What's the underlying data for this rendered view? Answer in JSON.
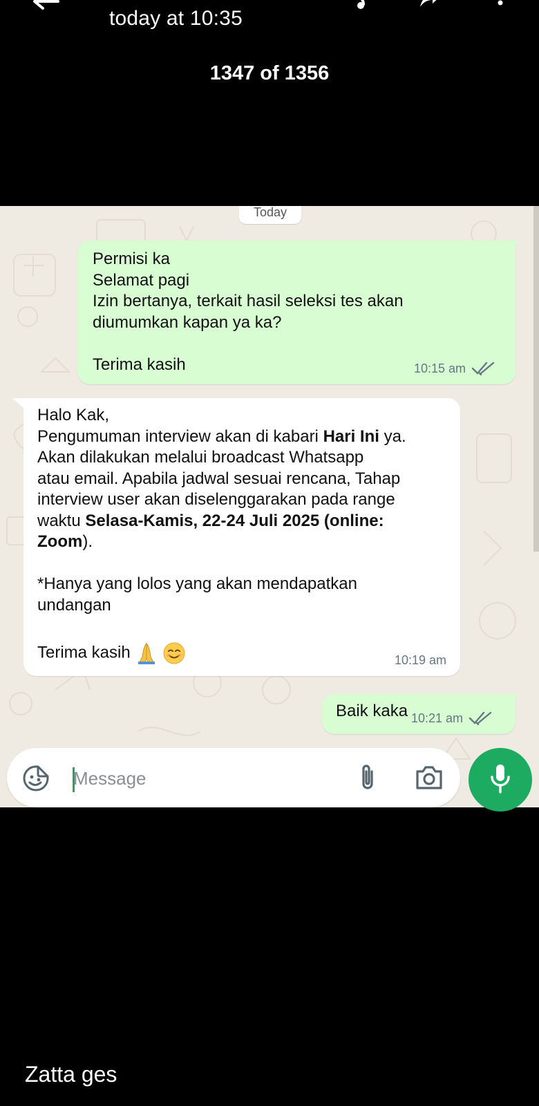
{
  "viewer": {
    "time": "today at 10:35",
    "counter": "1347 of 1356",
    "caption": "Zatta ges"
  },
  "chat": {
    "date_chip": "Today",
    "messages": [
      {
        "direction": "outgoing",
        "lines": [
          "Permisi ka",
          "Selamat pagi",
          "Izin bertanya, terkait hasil seleksi tes akan",
          "diumumkan kapan ya ka?",
          "",
          "Terima kasih"
        ],
        "time": "10:15 am",
        "status": "read"
      },
      {
        "direction": "incoming",
        "greeting": "Halo Kak,",
        "line2_pre": "Pengumuman interview akan di kabari ",
        "line2_bold": "Hari Ini",
        "line2_post": " ya.",
        "line3": "Akan dilakukan melalui broadcast Whatsapp",
        "line4": "atau email. Apabila jadwal sesuai rencana, Tahap",
        "line5": "interview user akan diselenggarakan pada range",
        "line6_pre": "waktu ",
        "line6_bold": "Selasa-Kamis, 22-24 Juli 2025 (online:",
        "line7_bold": "Zoom",
        "line7_post": ").",
        "line8": "*Hanya yang lolos yang akan mendapatkan",
        "line9": "undangan",
        "closing": "Terima kasih",
        "emojis": [
          "folded-hands",
          "smiling-face"
        ],
        "time": "10:19 am"
      },
      {
        "direction": "outgoing",
        "text": "Baik kaka",
        "time": "10:21 am",
        "status": "read"
      }
    ]
  },
  "composer": {
    "placeholder": "Message",
    "icons": [
      "sticker-icon",
      "attach-icon",
      "camera-icon",
      "mic-icon"
    ]
  },
  "colors": {
    "outgoing_bubble": "#d9fdd3",
    "incoming_bubble": "#ffffff",
    "chat_background": "#efeae2",
    "accent_green": "#1daa61",
    "read_ticks": "#667781"
  }
}
